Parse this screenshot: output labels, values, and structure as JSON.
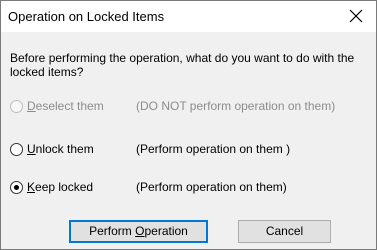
{
  "window": {
    "title": "Operation on Locked Items",
    "close_label": "×"
  },
  "prompt": "Before performing the operation, what do you want to do with the locked items?",
  "options": [
    {
      "label_underline": "D",
      "label_rest": "eselect them",
      "description": "(DO NOT perform operation on them)",
      "enabled": false,
      "selected": false
    },
    {
      "label_underline": "U",
      "label_rest": "nlock them",
      "description": "(Perform operation on them )",
      "enabled": true,
      "selected": false
    },
    {
      "label_underline": "K",
      "label_rest": "eep locked",
      "description": "(Perform operation on them)",
      "enabled": true,
      "selected": true
    }
  ],
  "buttons": {
    "perform_prefix": "Perform ",
    "perform_underline": "O",
    "perform_rest": "peration",
    "cancel": "Cancel"
  },
  "colors": {
    "accent": "#0078d7",
    "dialog_bg": "#f0f0f0",
    "titlebar_bg": "#ffffff",
    "disabled_text": "#8c8c8c"
  }
}
